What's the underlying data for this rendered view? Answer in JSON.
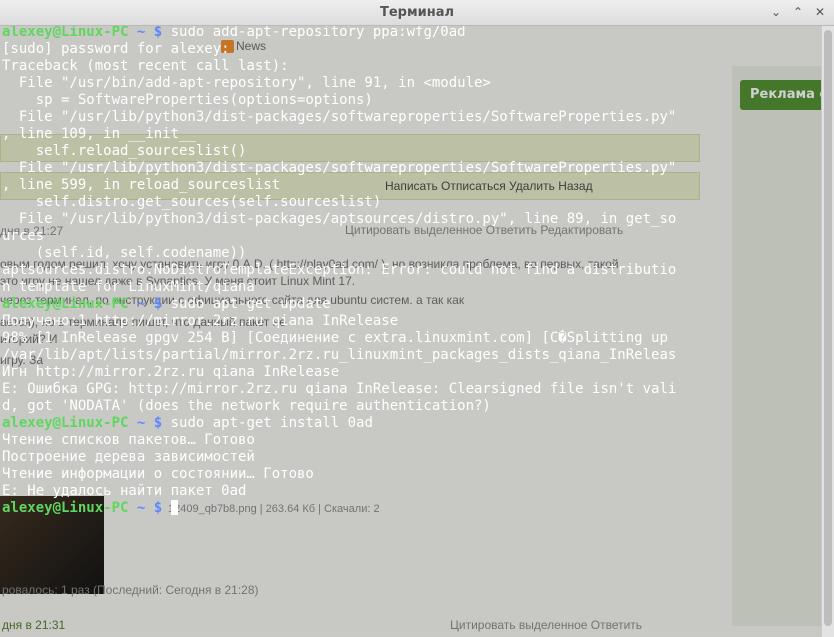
{
  "window": {
    "title": "Терминал",
    "controls": {
      "minimize": "⌄",
      "maximize": "⌃",
      "close": "✕"
    }
  },
  "background_page": {
    "news_label": "News",
    "banner": "Реклама с",
    "actions_1": "Написать   Отписаться   Удалить   Назад",
    "actions_2": "Цитировать выделенное   Ответить   Редактировать",
    "date_1": "дня в 21:27",
    "text_1": "овым годом решил, хочу установить игру 0.A.D. ( http://play0ad.com/ ), но возникла проблема, во первых, такой",
    "text_2": "                                                        это игру не нашел даже в Synaptics. У меня стоит Linux Mint 17.",
    "text_3": "                     через терминал, по инструкции с официального сайта для ubuntu систем. а так как",
    "text_4": "                                                  ается), но в терминале пишет, что данный пакет не",
    "text_5": "                                                                                                      иторий? И",
    "text_6": "                                                                                                      игру. За",
    "file_info": "12409_qb7b8.png | 263.64 Кб | Скачали: 2",
    "downloaded": "ровалось: 1 раз (Последний: Сегодня в 21:28)",
    "date_2": "дня в 21:31",
    "actions_3": "Цитировать выделенное   Ответить"
  },
  "terminal": {
    "lines": [
      {
        "type": "prompt",
        "user": "alexey@Linux-PC",
        "path": " ~ $",
        "cmd": " sudo add-apt-repository ppa:wfg/0ad"
      },
      {
        "type": "text",
        "text": "[sudo] password for alexey:"
      },
      {
        "type": "text",
        "text": "Traceback (most recent call last):"
      },
      {
        "type": "text",
        "text": "  File \"/usr/bin/add-apt-repository\", line 91, in <module>"
      },
      {
        "type": "text",
        "text": "    sp = SoftwareProperties(options=options)"
      },
      {
        "type": "text",
        "text": "  File \"/usr/lib/python3/dist-packages/softwareproperties/SoftwareProperties.py\""
      },
      {
        "type": "text",
        "text": ", line 109, in __init__"
      },
      {
        "type": "text",
        "text": "    self.reload_sourceslist()"
      },
      {
        "type": "text",
        "text": "  File \"/usr/lib/python3/dist-packages/softwareproperties/SoftwareProperties.py\""
      },
      {
        "type": "text",
        "text": ", line 599, in reload_sourceslist"
      },
      {
        "type": "text",
        "text": "    self.distro.get_sources(self.sourceslist)"
      },
      {
        "type": "text",
        "text": "  File \"/usr/lib/python3/dist-packages/aptsources/distro.py\", line 89, in get_so"
      },
      {
        "type": "text",
        "text": "urces"
      },
      {
        "type": "text",
        "text": "    (self.id, self.codename))"
      },
      {
        "type": "text",
        "text": "aptsources.distro.NoDistroTemplateException: Error: could not find a distributio"
      },
      {
        "type": "text",
        "text": "n template for LinuxMint/qiana"
      },
      {
        "type": "prompt",
        "user": "alexey@Linux-PC",
        "path": " ~ $",
        "cmd": " sudo apt-get update"
      },
      {
        "type": "text",
        "text": "Получено:1 http://mirror.2rz.ru qiana InRelease"
      },
      {
        "type": "text",
        "text": "98% [1 InRelease gpgv 254 B] [Соединение с extra.linuxmint.com] [C�Splitting up"
      },
      {
        "type": "text",
        "text": "/var/lib/apt/lists/partial/mirror.2rz.ru_linuxmint_packages_dists_qiana_InReleas"
      },
      {
        "type": "text",
        "text": "Игн http://mirror.2rz.ru qiana InRelease"
      },
      {
        "type": "text",
        "text": "E: Ошибка GPG: http://mirror.2rz.ru qiana InRelease: Clearsigned file isn't vali"
      },
      {
        "type": "text",
        "text": "d, got 'NODATA' (does the network require authentication?)"
      },
      {
        "type": "prompt",
        "user": "alexey@Linux-PC",
        "path": " ~ $",
        "cmd": " sudo apt-get install 0ad"
      },
      {
        "type": "text",
        "text": "Чтение списков пакетов… Готово"
      },
      {
        "type": "text",
        "text": "Построение дерева зависимостей"
      },
      {
        "type": "text",
        "text": "Чтение информации о состоянии… Готово"
      },
      {
        "type": "text",
        "text": "E: Не удалось найти пакет 0ad"
      },
      {
        "type": "prompt",
        "user": "alexey@Linux-PC",
        "path": " ~ $",
        "cmd": " "
      }
    ]
  },
  "colors": {
    "prompt_user": "#5fd75f",
    "prompt_path": "#5f87ff",
    "text": "#ffffff",
    "background": "#2b2b2b"
  }
}
